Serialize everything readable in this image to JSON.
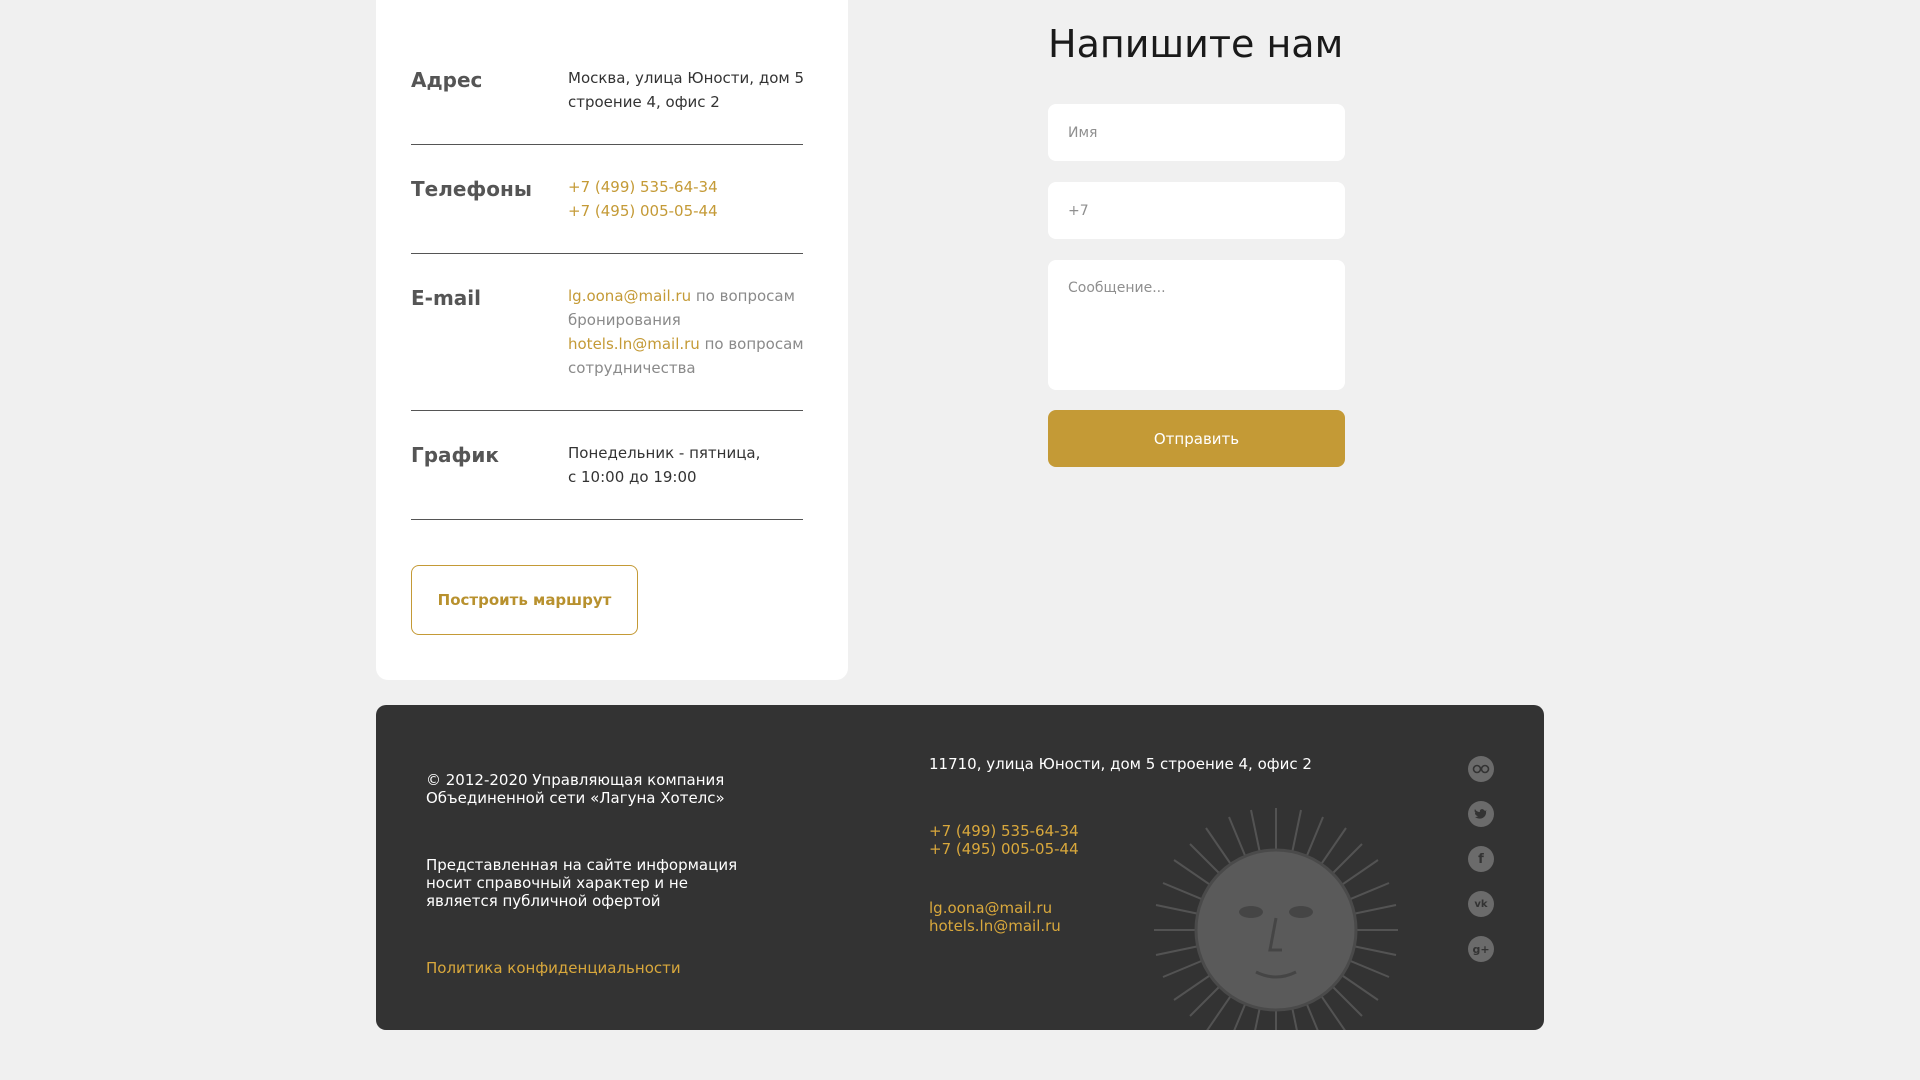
{
  "contacts": {
    "address": {
      "label": "Адрес",
      "line1": "Москва, улица Юности, дом 5",
      "line2": "строение 4, офис 2"
    },
    "phones": {
      "label": "Телефоны",
      "phone1": "+7 (499) 535-64-34",
      "phone2": "+7 (495) 005-05-44"
    },
    "email": {
      "label": "E-mail",
      "email1": "lg.oona@mail.ru",
      "email1_note_a": " по вопросам",
      "email1_note_b": "бронирования",
      "email2": "hotels.ln@mail.ru",
      "email2_note_a": " по вопросам",
      "email2_note_b": "сотрудничества"
    },
    "schedule": {
      "label": "График",
      "line1": "Понедельник - пятница,",
      "line2": "с 10:00 до 19:00"
    },
    "route_button": "Построить маршрут"
  },
  "form": {
    "title": "Напишите нам",
    "name_placeholder": "Имя",
    "phone_placeholder": "+7",
    "message_placeholder": "Сообщение...",
    "submit_label": "Отправить"
  },
  "footer": {
    "copyright_line1": "© 2012-2020 Управляющая компания",
    "copyright_line2": "Объединенной сети «Лагуна Хотелс»",
    "disclaimer_line1": "Представленная на сайте информация",
    "disclaimer_line2": "носит справочный характер и не",
    "disclaimer_line3": "является публичной офертой",
    "privacy_link": "Политика конфиденциальности",
    "address": "11710, улица Юности, дом 5 строение 4, офис 2",
    "phone1": "+7 (499) 535-64-34",
    "phone2": "+7 (495) 005-05-44",
    "email1": "lg.oona@mail.ru",
    "email2": "hotels.ln@mail.ru",
    "social_icons": [
      "tripadvisor-icon",
      "twitter-icon",
      "facebook-icon",
      "vk-icon",
      "google-plus-icon"
    ]
  },
  "colors": {
    "accent": "#c49a36",
    "footer_bg": "#333333",
    "page_bg": "#f0f0f0"
  }
}
